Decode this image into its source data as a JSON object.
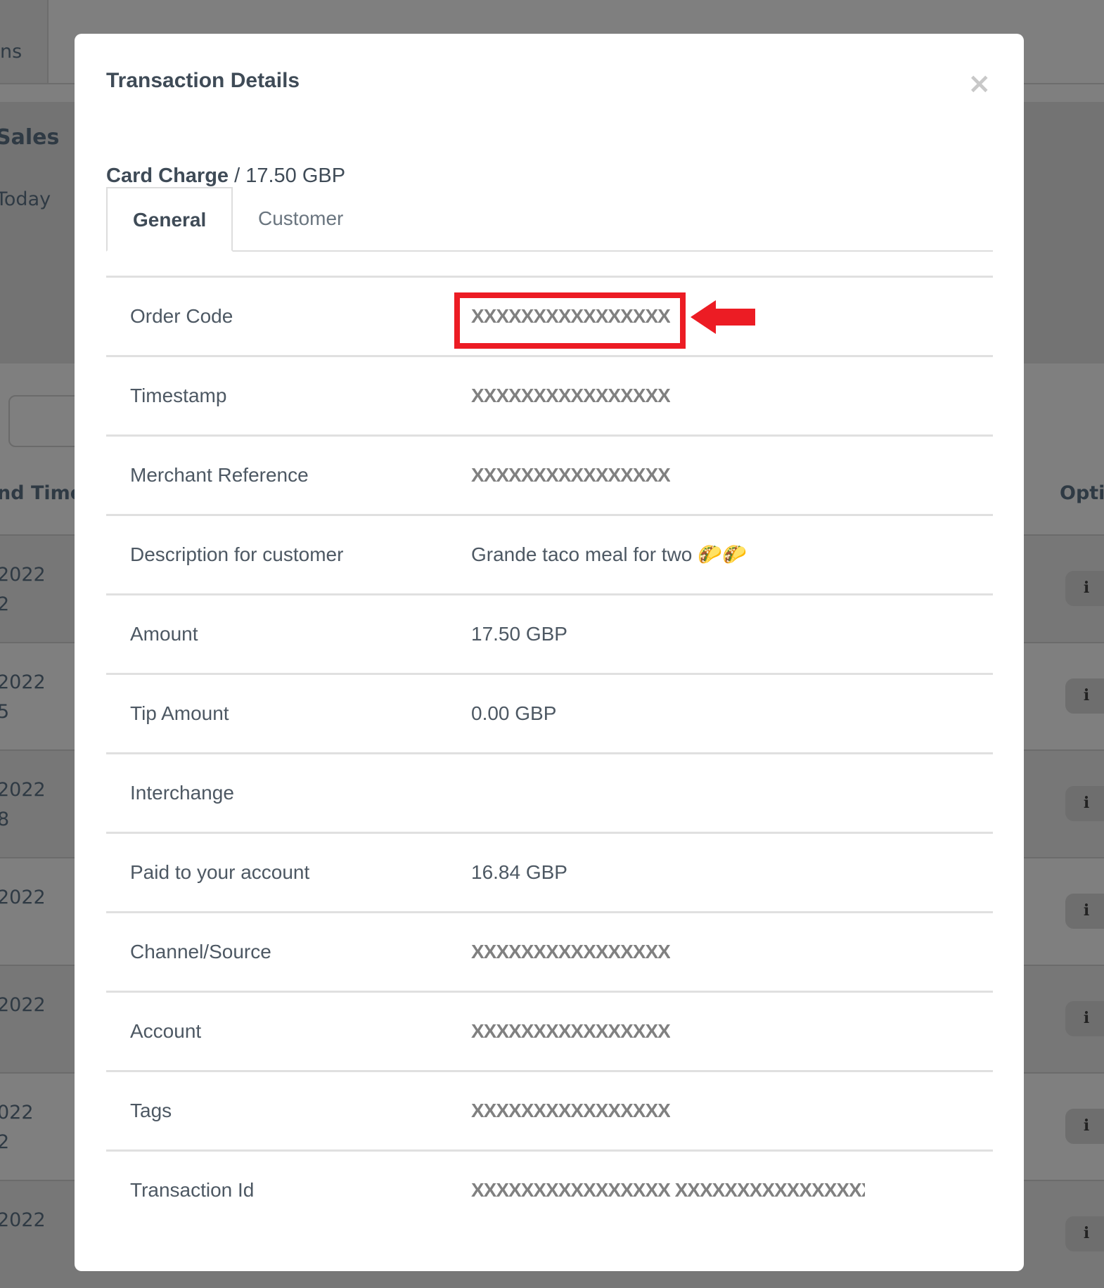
{
  "background": {
    "tab_fragment": "ns",
    "section_fragment": "Sales",
    "period_fragment": "Today",
    "column_fragment": "nd Time",
    "options_fragment": "Opti",
    "rows": [
      {
        "date": "2022",
        "time": "2"
      },
      {
        "date": "2022",
        "time": "5"
      },
      {
        "date": "2022",
        "time": "8"
      },
      {
        "date": "2022",
        "time": ""
      },
      {
        "date": "2022",
        "time": ""
      },
      {
        "date": "022",
        "time": "2"
      },
      {
        "date": "2022",
        "time": ""
      }
    ],
    "info_button_label": "i"
  },
  "modal": {
    "title": "Transaction Details",
    "close_label": "×",
    "subtitle_type": "Card Charge",
    "subtitle_sep": " / ",
    "subtitle_amount": "17.50 GBP",
    "tabs": [
      {
        "label": "General",
        "active": true
      },
      {
        "label": "Customer",
        "active": false
      }
    ],
    "rows": [
      {
        "label": "Order Code",
        "value": "XXXXXXXXXXXXXXXX",
        "masked": true,
        "highlighted": true
      },
      {
        "label": "Timestamp",
        "value": "XXXXXXXXXXXXXXXX",
        "masked": true
      },
      {
        "label": "Merchant Reference",
        "value": "XXXXXXXXXXXXXXXX",
        "masked": true
      },
      {
        "label": "Description for customer",
        "value": "Grande taco meal for two 🌮🌮",
        "masked": false
      },
      {
        "label": "Amount",
        "value": "17.50 GBP",
        "masked": false
      },
      {
        "label": "Tip Amount",
        "value": "0.00 GBP",
        "masked": false
      },
      {
        "label": "Interchange",
        "value": "",
        "masked": false
      },
      {
        "label": "Paid to your account",
        "value": "16.84 GBP",
        "masked": false
      },
      {
        "label": "Channel/Source",
        "value": "XXXXXXXXXXXXXXXX",
        "masked": true
      },
      {
        "label": "Account",
        "value": "XXXXXXXXXXXXXXXX",
        "masked": true
      },
      {
        "label": "Tags",
        "value": "XXXXXXXXXXXXXXXX",
        "masked": true
      },
      {
        "label": "Transaction Id",
        "value": "XXXXXXXXXXXXXXXX XXXXXXXXXXXXXXXX",
        "masked": true
      }
    ]
  },
  "colors": {
    "overlay": "#7f7f7f",
    "highlight": "#ec1c24",
    "masked_text": "#808080",
    "text": "#4d5863"
  }
}
